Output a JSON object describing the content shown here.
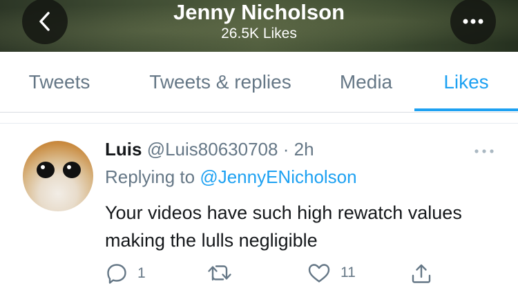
{
  "header": {
    "title": "Jenny Nicholson",
    "subtitle": "26.5K Likes"
  },
  "tabs": [
    {
      "label": "Tweets",
      "active": false
    },
    {
      "label": "Tweets & replies",
      "active": false
    },
    {
      "label": "Media",
      "active": false
    },
    {
      "label": "Likes",
      "active": true
    }
  ],
  "tweet": {
    "name": "Luis",
    "handle": "@Luis80630708",
    "separator": "·",
    "time": "2h",
    "replying_prefix": "Replying to",
    "replying_to": "@JennyENicholson",
    "text": "Your videos have such high rewatch values making the lulls negligible",
    "actions": {
      "reply_count": "1",
      "retweet_count": "",
      "like_count": "11"
    }
  },
  "colors": {
    "accent": "#1da1f2",
    "muted": "#657786",
    "text": "#14171a"
  },
  "icons": [
    "back-arrow-icon",
    "more-icon",
    "reply-icon",
    "retweet-icon",
    "like-icon",
    "share-icon"
  ]
}
